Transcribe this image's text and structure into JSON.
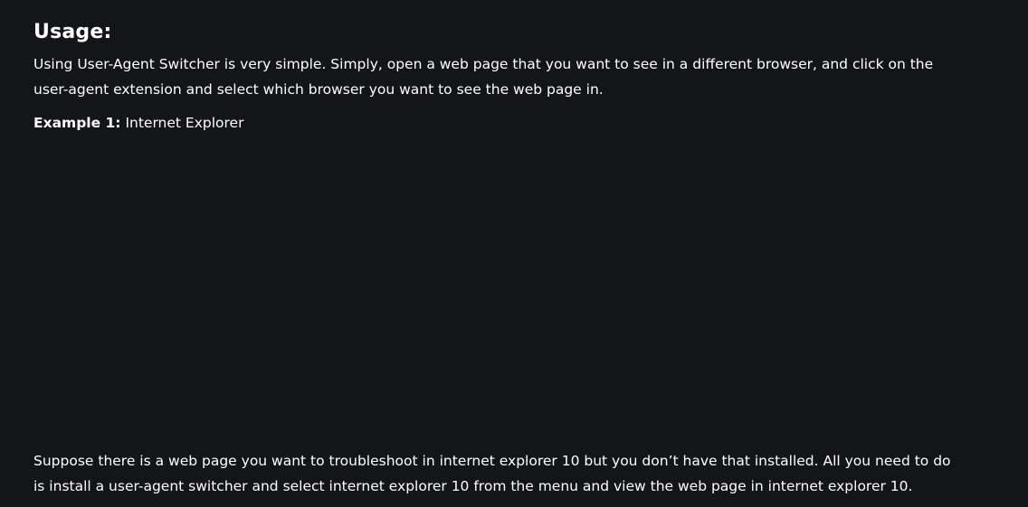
{
  "usage": {
    "heading": "Usage:",
    "intro": "Using User-Agent Switcher is very simple. Simply, open a web page that you want to see in a different browser, and click on the user-agent extension and select which browser you want to see the web page in.",
    "example_label": "Example 1:",
    "example_text": "Internet Explorer",
    "outro": "Suppose there is a web page you want to troubleshoot in internet explorer 10 but you don’t have that installed. All you need to do is install a user-agent switcher and select internet explorer 10 from the menu and view the web page in internet explorer 10."
  },
  "colors": {
    "background": "#141519",
    "text": "#ffffff"
  }
}
